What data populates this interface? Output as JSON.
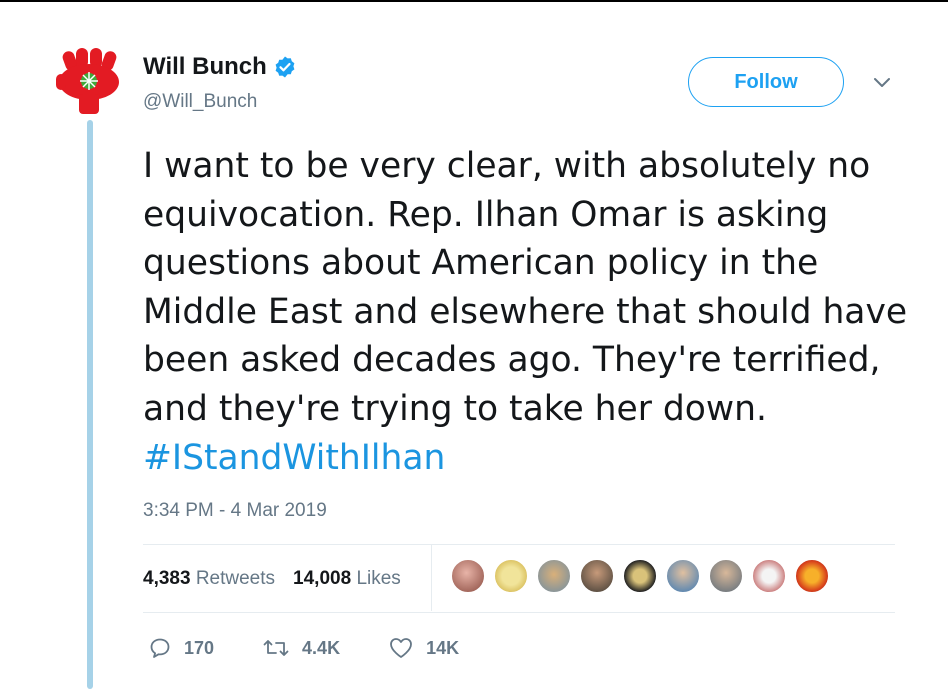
{
  "user": {
    "display_name": "Will Bunch",
    "handle": "@Will_Bunch",
    "verified": true,
    "avatar_icon": "red-fist-icon"
  },
  "follow_label": "Follow",
  "tweet": {
    "text_before": "I want to be very clear, with absolutely no equivocation. Rep. Ilhan Omar is asking questions about American policy in the Middle East and elsewhere that should have been asked decades ago. They're terrified, and they're trying to take her down. ",
    "hashtag": "#IStandWithIlhan"
  },
  "timestamp": "3:34 PM - 4 Mar 2019",
  "stats": {
    "retweets_count": "4,383",
    "retweets_label": "Retweets",
    "likes_count": "14,008",
    "likes_label": "Likes"
  },
  "actions": {
    "reply_count": "170",
    "retweet_count": "4.4K",
    "like_count": "14K"
  },
  "colors": {
    "accent": "#1da1f2",
    "hashtag": "#1b95e0",
    "secondary_text": "#657786",
    "thread_line": "#a6d2e8"
  }
}
